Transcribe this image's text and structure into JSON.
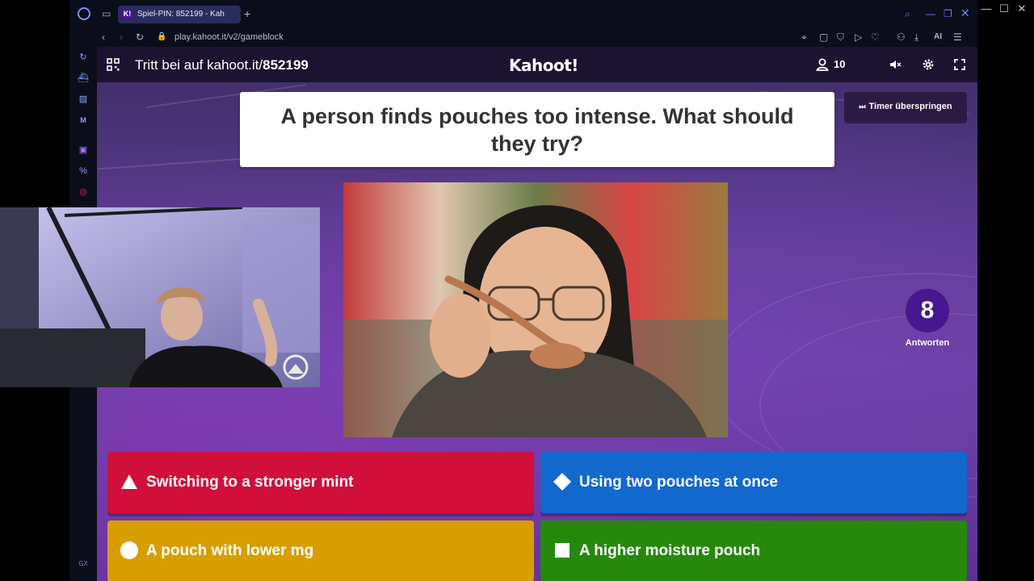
{
  "browser": {
    "tab_title": "Spiel-PIN: 852199 - Kah",
    "tab_favicon": "K!",
    "new_tab_glyph": "+",
    "url": "play.kahoot.it/v2/gameblock",
    "ai_label": "AI"
  },
  "os": {
    "minimize": "—",
    "maximize": "☐",
    "close": "✕"
  },
  "sidebar": {
    "bottom_label": "GX"
  },
  "kahoot": {
    "join_prefix": "Tritt bei auf kahoot.it/",
    "pin": "852199",
    "logo": "Kahoot!",
    "player_count": "10",
    "question": "A person finds pouches too intense. What should they try?",
    "skip_label": "Timer überspringen",
    "answers_count": "8",
    "answers_label": "Antworten",
    "answers": [
      {
        "text": "Switching to a stronger mint",
        "shape": "triangle",
        "color": "#d0103a"
      },
      {
        "text": "Using two pouches at once",
        "shape": "diamond",
        "color": "#1368ce"
      },
      {
        "text": "A pouch with lower mg",
        "shape": "circle",
        "color": "#d89e00"
      },
      {
        "text": "A higher moisture pouch",
        "shape": "square",
        "color": "#26890c"
      }
    ]
  },
  "icons": {
    "grid": "qr-grid-icon",
    "user": "user-icon",
    "volume": "volume-icon",
    "settings": "gear-icon",
    "fullscreen": "fullscreen-icon"
  }
}
